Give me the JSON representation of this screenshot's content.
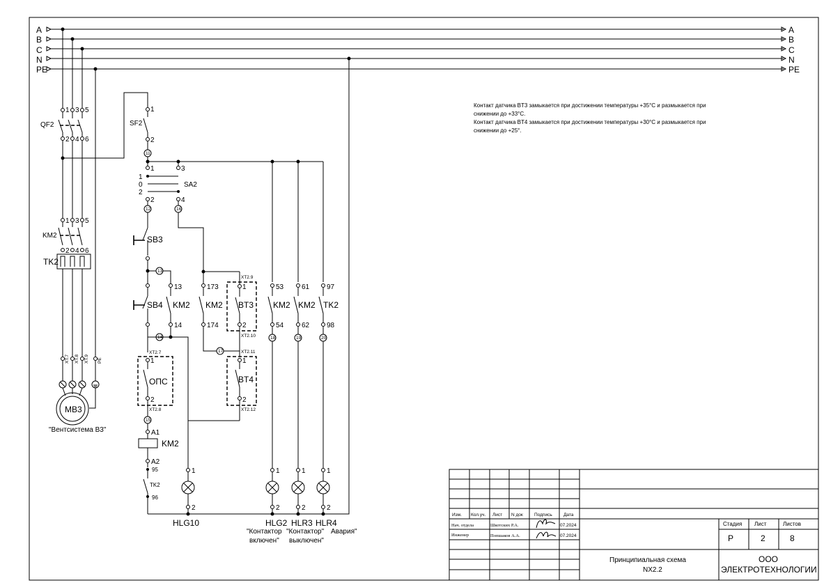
{
  "buses": [
    "A",
    "B",
    "C",
    "N",
    "PE"
  ],
  "notes": [
    "Контакт датчика BT3 замыкается при достижении температуры +35°C и размыкается при",
    "снижении до +33°C.",
    "Контакт датчика BT4 замыкается при достижении температуры +30°C и размыкается при",
    "снижении до +25°."
  ],
  "components": {
    "qf2": "QF2",
    "km2": "KM2",
    "tk2": "TK2",
    "sf2": "SF2",
    "sa2": "SA2",
    "sb3": "SB3",
    "sb4": "SB4",
    "ops": "ОПС",
    "bt3": "BT3",
    "bt4": "BT4",
    "motor": "MB3",
    "motor_caption": "\"Вентсистема В3\"",
    "coil_label": "KM2",
    "tk_contact": "TK2",
    "km2_a": "KM2",
    "km2_b": "KM2",
    "km2_c": "KM2",
    "km2_d": "KM2",
    "tk2_b": "TK2"
  },
  "terminals": {
    "p1": "1",
    "p3": "3",
    "p5": "5",
    "p2": "2",
    "p4": "4",
    "p6": "6",
    "sf1": "1",
    "sf2": "2",
    "w11": "11",
    "sa1": "1",
    "sa3": "3",
    "sa2b": "2",
    "sa4": "4",
    "w12": "12",
    "w16": "16",
    "w13": "13",
    "n13": "13",
    "n14": "14",
    "w14": "14",
    "n173": "173",
    "n174": "174",
    "w17": "17",
    "xt29": "XT2.9",
    "xt210": "XT2.10",
    "xt211": "XT2.11",
    "xt212": "XT2.12",
    "xt27": "XT2.7",
    "xt28": "XT2.8",
    "n53": "53",
    "n54": "54",
    "n61": "61",
    "n62": "62",
    "n97": "97",
    "n98": "98",
    "w18": "18",
    "w19": "19",
    "w20": "20",
    "w15": "15",
    "a1": "A1",
    "a2": "A2",
    "n95": "95",
    "n96": "96",
    "c1": "1",
    "c2": "2",
    "x7": "XT.7",
    "x8": "XT.8",
    "x9": "XT.9",
    "xpe": "PE",
    "sa_pos1": "1",
    "sa_pos0": "0",
    "sa_pos2": "2"
  },
  "lamps": [
    {
      "tag": "HLG10",
      "caption": ""
    },
    {
      "tag": "HLG2",
      "caption": "\"Контактор включен\""
    },
    {
      "tag": "HLR3",
      "caption": "\"Контактор выключен\""
    },
    {
      "tag": "HLR4",
      "caption": "\"Авария\""
    }
  ],
  "lamp_caption_lines": {
    "hlg2_l1": "\"Контактор",
    "hlg2_l2": "включен\"",
    "hlr3_l1": "\"Контактор\"",
    "hlr3_l2": "выключен\"",
    "hlr4_l1": "Авария\""
  },
  "title_block": {
    "headers": {
      "izm": "Изм.",
      "koluch": "Кол.уч.",
      "list": "Лист",
      "ndoc": "N док",
      "podpis": "Подпись",
      "data": "Дата"
    },
    "rows": [
      {
        "role": "Нач. отдела",
        "name": "Шкотских Р.А.",
        "date": "07.2024"
      },
      {
        "role": "Инженер",
        "name": "Попшаков А.А.",
        "date": "07.2024"
      }
    ],
    "stage_label": "Стадия",
    "sheet_label": "Лист",
    "sheets_label": "Листов",
    "stage": "Р",
    "sheet": "2",
    "sheets": "8",
    "title_l1": "Принципиальная схема",
    "title_l2": "NX2.2",
    "org_l1": "ООО",
    "org_l2": "ЭЛЕКТРОТЕХНОЛОГИИ"
  }
}
